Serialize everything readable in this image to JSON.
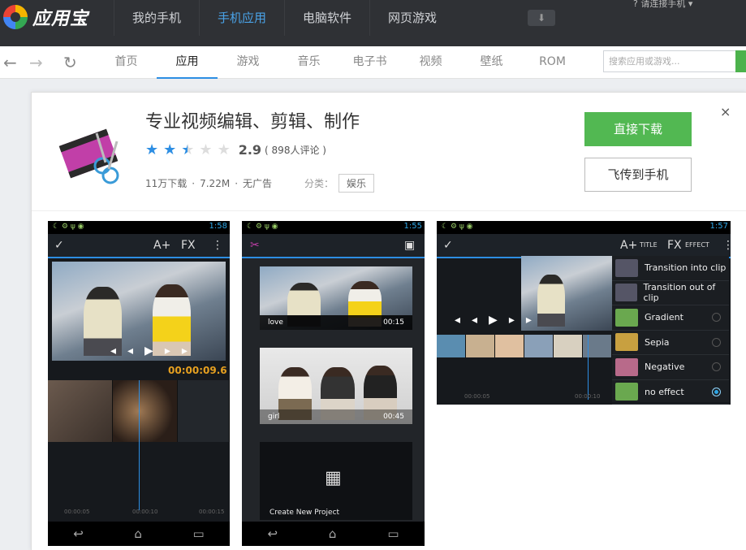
{
  "app": {
    "brand": "应用宝"
  },
  "topnav": {
    "items": [
      "我的手机",
      "手机应用",
      "电脑软件",
      "网页游戏"
    ],
    "active_index": 1,
    "connect": "请连接手机"
  },
  "tabs": {
    "items": [
      "首页",
      "应用",
      "游戏",
      "音乐",
      "电子书",
      "视频",
      "壁纸",
      "ROM"
    ],
    "active_index": 1
  },
  "search": {
    "placeholder": "搜索应用或游戏..."
  },
  "detail": {
    "title": "专业视频编辑、剪辑、制作",
    "rating": 2.5,
    "score": "2.9",
    "reviews": "( 898人评论 )",
    "downloads": "11万下载",
    "size": "7.22M",
    "ads": "无广告",
    "sep": "·",
    "category_label": "分类：",
    "category": "娱乐",
    "download_btn": "直接下载",
    "send_btn": "飞传到手机",
    "close": "×"
  },
  "shot1": {
    "time": "1:58",
    "timecode": "00:00:09.6",
    "ticks": [
      "00:00:05",
      "00:00:10",
      "00:00:15"
    ]
  },
  "shot2": {
    "time": "1:55",
    "clips": [
      {
        "name": "love",
        "dur": "00:15"
      },
      {
        "name": "girl",
        "dur": "00:45"
      }
    ],
    "create": "Create New Project"
  },
  "shot3": {
    "time": "1:57",
    "title_label": "TITLE",
    "effect_label": "EFFECT",
    "ticks": [
      "00:00:05",
      "00:00:10"
    ],
    "menu": [
      {
        "label": "Transition into clip",
        "color": "#556",
        "radio": null
      },
      {
        "label": "Transition out of clip",
        "color": "#556",
        "radio": null
      },
      {
        "label": "Gradient",
        "color": "#6aa84f",
        "radio": false
      },
      {
        "label": "Sepia",
        "color": "#c8a040",
        "radio": false
      },
      {
        "label": "Negative",
        "color": "#b86a8a",
        "radio": false
      },
      {
        "label": "no effect",
        "color": "#6aa84f",
        "radio": true
      }
    ]
  }
}
